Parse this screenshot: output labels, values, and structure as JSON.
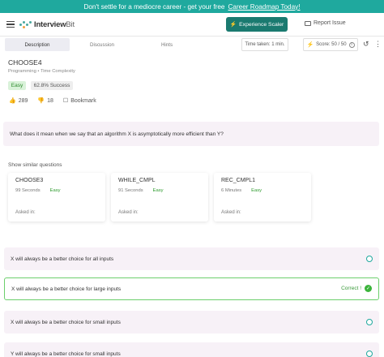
{
  "banner": {
    "text": "Don't settle for a mediocre career - get your free",
    "link": "Career Roadmap Today!"
  },
  "header": {
    "logo_main": "Interview",
    "logo_suffix": "Bit",
    "experience_button": "Experience Scaler",
    "report_issue": "Report Issue"
  },
  "tabs": [
    {
      "label": "Description",
      "active": true
    },
    {
      "label": "Discussion",
      "active": false
    },
    {
      "label": "Hints",
      "active": false
    }
  ],
  "toolbar": {
    "timer": "Time taken: 1 min.",
    "score": "Score: 50 / 50"
  },
  "problem": {
    "title": "CHOOSE4",
    "tags": "Programming • Time Complexity",
    "difficulty": "Easy",
    "success_rate": "62.8% Success",
    "upvotes": "289",
    "downvotes": "18",
    "bookmark": "Bookmark",
    "question": "What does it mean when we say that an algorithm X is asymptotically more efficient than Y?"
  },
  "similar": {
    "title": "Show similar questions",
    "items": [
      {
        "name": "CHOOSE3",
        "time": "99 Seconds",
        "difficulty": "Easy",
        "asked": "Asked in:"
      },
      {
        "name": "WHILE_CMPL",
        "time": "91 Seconds",
        "difficulty": "Easy",
        "asked": "Asked in:"
      },
      {
        "name": "REC_CMPL1",
        "time": "6 Minutes",
        "difficulty": "Easy",
        "asked": "Asked in:"
      }
    ]
  },
  "options": [
    {
      "text": "X will always be a better choice for all inputs",
      "correct": false
    },
    {
      "text": "X will always be a better choice for large inputs",
      "correct": true,
      "status": "Correct !"
    },
    {
      "text": "X will always be a better choice for small inputs",
      "correct": false
    },
    {
      "text": "Y will always be a better choice for small inputs",
      "correct": false
    }
  ],
  "colors": {
    "brand": "#1fa99e",
    "button": "#1a7a70",
    "correct": "#3cb43c",
    "option_bg": "#f7f1f7"
  }
}
